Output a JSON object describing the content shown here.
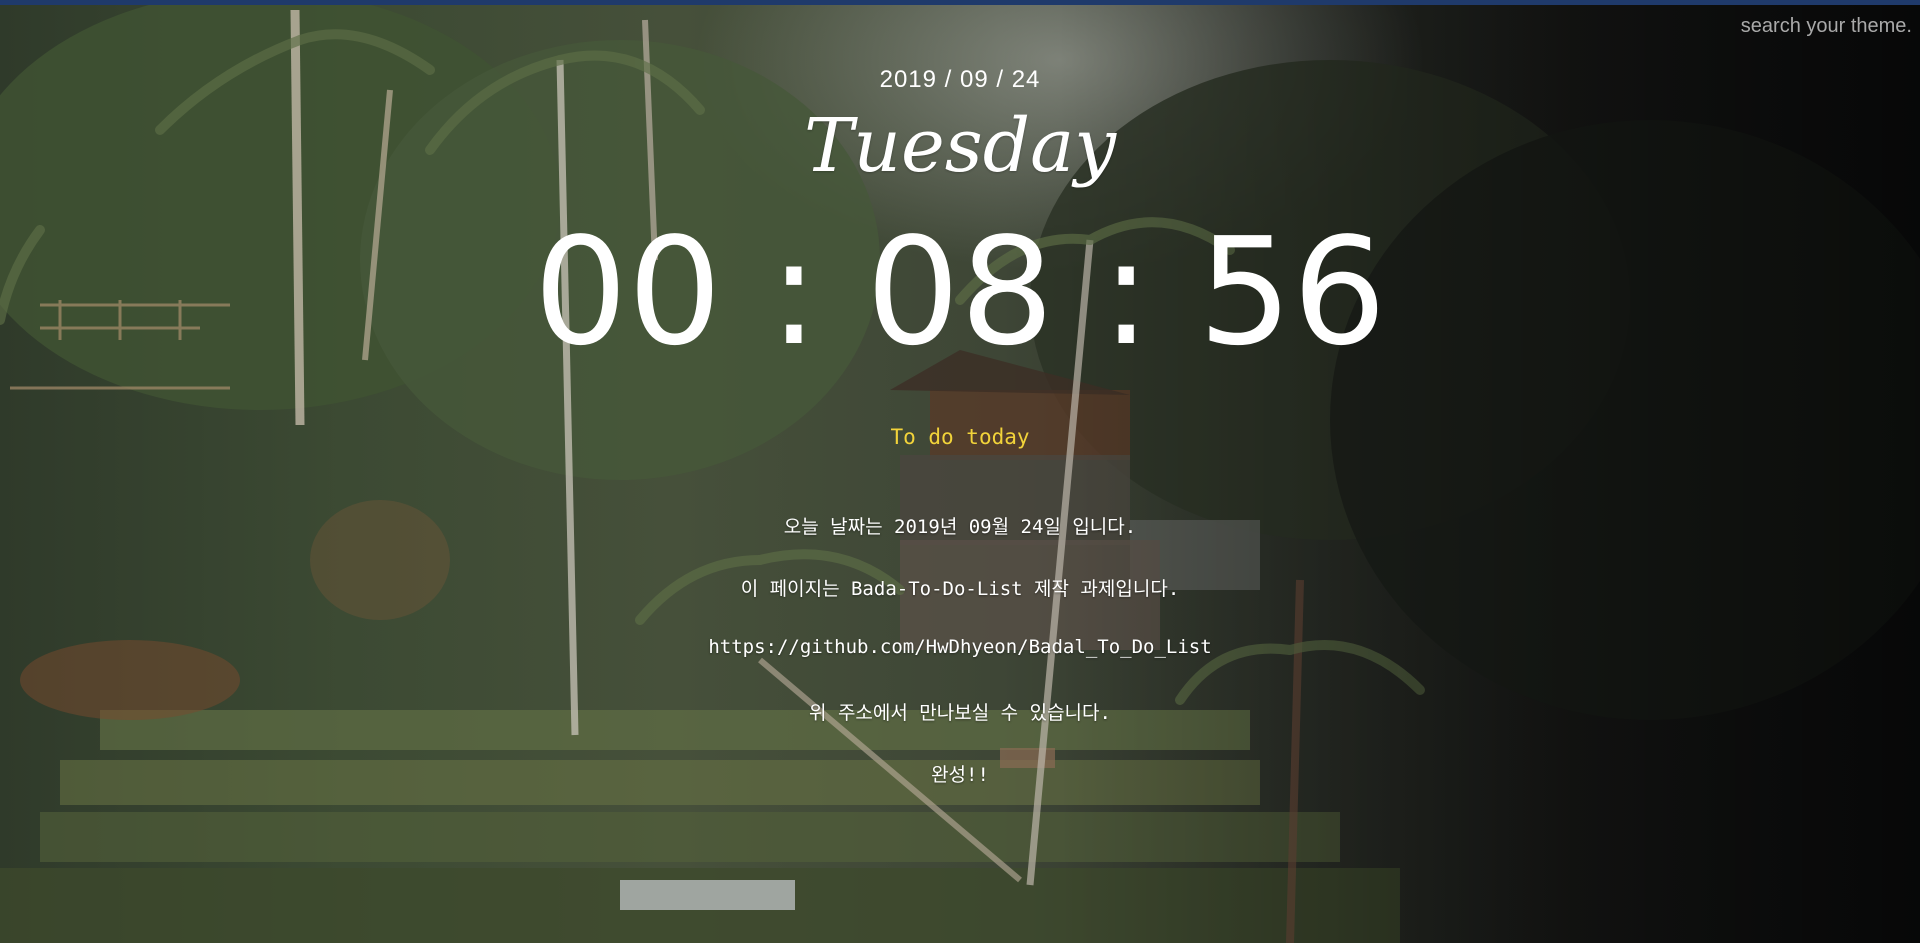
{
  "search": {
    "placeholder": "search your theme."
  },
  "clock": {
    "date": "2019 / 09 / 24",
    "weekday": "Tuesday",
    "time": "00 : 08 : 56"
  },
  "todo": {
    "title": "To do today",
    "items": [
      "오늘 날짜는 2019년 09월 24일 입니다.",
      "이 페이지는 Bada-To-Do-List 제작 과제입니다.",
      "https://github.com/HwDhyeon/Badal_To_Do_List",
      "위 주소에서 만나보실 수 있습니다.",
      "완성!!"
    ]
  },
  "colors": {
    "top_bar": "#1f3a6b",
    "todo_title": "#f2d33a",
    "text": "#ffffff",
    "search_placeholder": "#a9a9a9"
  }
}
